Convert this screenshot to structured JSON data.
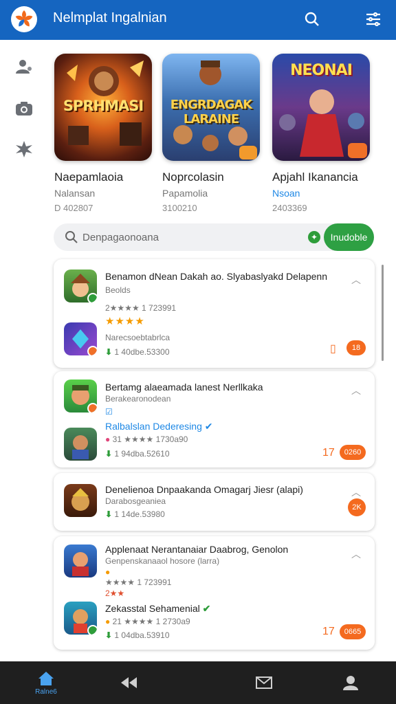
{
  "header": {
    "title": "Nelmplat Ingalnian",
    "search_icon": "search-icon",
    "menu_icon": "filter-menu-icon"
  },
  "rail": {
    "icons": [
      "profile-icon",
      "camera-icon",
      "puzzle-icon"
    ]
  },
  "featured": [
    {
      "art_text": "SPRHMASI",
      "name": "Naepamlaoia",
      "sub": "Nalansan",
      "count": "D 402807",
      "accent": "#f08020"
    },
    {
      "art_text": "ENGRDAGAK LARAINE",
      "name": "Noprcolasin",
      "sub": "Papamolia",
      "count": "3100210",
      "accent": "#4a8fd8"
    },
    {
      "art_text": "NEONAI",
      "name": "Apjahl Ikanancia",
      "sub": "Nsoan",
      "count": "2403369",
      "accent": "#e03060"
    }
  ],
  "search": {
    "placeholder": "Denpagaonoana",
    "button": "Inudoble"
  },
  "cards": [
    {
      "title": "Benamon dNean Dakah ao. Slyabaslyakd Delapenn",
      "sub": "Beolds",
      "rating_line": "2★★★★ 1 723991",
      "stars": "★★★★",
      "item2_title": "Narecsoebtabrlca",
      "item2_count": "1 40dbe.53300",
      "num": "18"
    },
    {
      "title": "Bertamg alaeamada lanest Nerllkaka",
      "sub": "Berakearonodean",
      "link": "Ralbalslan Dederesing",
      "rating_line": "31 ★★★★ 1730a90",
      "item2_count": "1 94dba.52610",
      "num": "17",
      "pill": "0260"
    },
    {
      "title": "Denelienoa Dnpaakanda Omagarj Jiesr (alapi)",
      "sub": "Darabosgeaniea",
      "item2_count": "1 14de.53980",
      "pill": "2K"
    },
    {
      "title": "Applenaat Nerantanaiar Daabrog, Genolon",
      "sub": "Genpenskanaaol hosore (larra)",
      "rating_line": "★★★★ 1 723991",
      "rating_line2": "2★★",
      "item2_title": "Zekasstal Sehamenial",
      "rating_line3": "21 ★★★★ 1 2730a9",
      "item2_count": "1 04dba.53910",
      "num": "17",
      "pill": "0665"
    }
  ],
  "bottom_nav": {
    "home_label": "Ralne6"
  },
  "colors": {
    "primary": "#1565c0",
    "accent": "#f46a1f",
    "success": "#2ea043"
  }
}
